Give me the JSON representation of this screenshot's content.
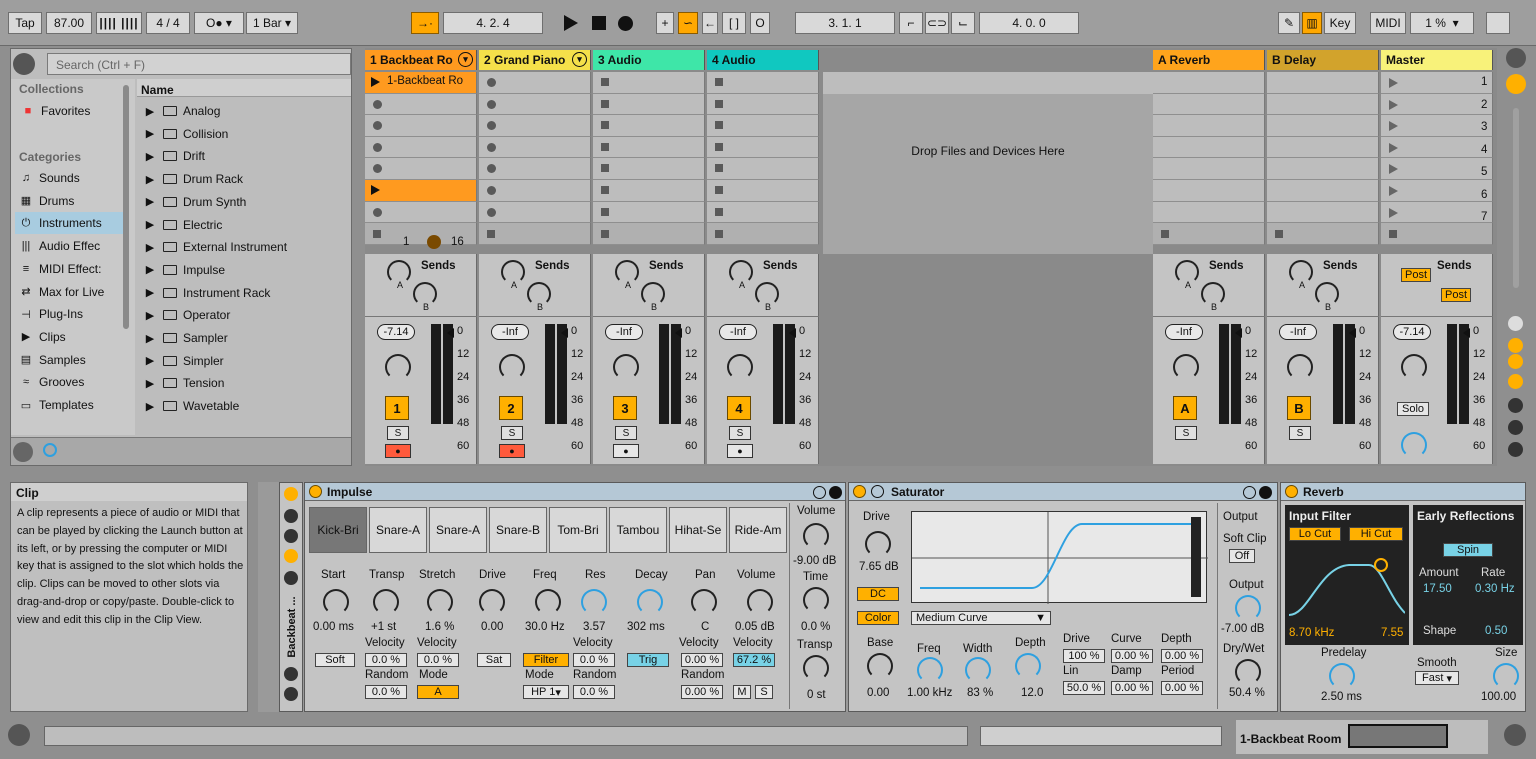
{
  "transport": {
    "tap": "Tap",
    "tempo": "87.00",
    "signature": "4 / 4",
    "quantize": "1 Bar",
    "arrangement_pos": "4.  2.  4",
    "loop_start": "3.  1.  1",
    "loop_length": "4.  0.  0",
    "key": "Key",
    "midi": "MIDI",
    "cpu": "1 %"
  },
  "browser": {
    "search_placeholder": "Search (Ctrl + F)",
    "collections_header": "Collections",
    "favorites": "Favorites",
    "categories_header": "Categories",
    "name_header": "Name",
    "categories": [
      "Sounds",
      "Drums",
      "Instruments",
      "Audio Effec",
      "MIDI Effect:",
      "Max for Live",
      "Plug-Ins",
      "Clips",
      "Samples",
      "Grooves",
      "Templates"
    ],
    "items": [
      "Analog",
      "Collision",
      "Drift",
      "Drum Rack",
      "Drum Synth",
      "Electric",
      "External Instrument",
      "Impulse",
      "Instrument Rack",
      "Operator",
      "Sampler",
      "Simpler",
      "Tension",
      "Wavetable"
    ]
  },
  "session": {
    "drop_text": "Drop Files and Devices Here",
    "tracks": [
      {
        "name": "1 Backbeat Ro",
        "color": "#ff9a1f",
        "volume": "-7.14",
        "num": "1",
        "clip": "1-Backbeat Ro"
      },
      {
        "name": "2 Grand Piano",
        "color": "#f5e04a",
        "volume": "-Inf",
        "num": "2"
      },
      {
        "name": "3 Audio",
        "color": "#3ee6a8",
        "volume": "-Inf",
        "num": "3"
      },
      {
        "name": "4 Audio",
        "color": "#10c8c0",
        "volume": "-Inf",
        "num": "4"
      }
    ],
    "returns": [
      {
        "name": "A Reverb",
        "color": "#ffa41c",
        "volume": "-Inf",
        "num": "A"
      },
      {
        "name": "B Delay",
        "color": "#d2a32c",
        "volume": "-Inf",
        "num": "B"
      }
    ],
    "master": {
      "name": "Master",
      "color": "#f8f27a",
      "volume": "-7.14",
      "solo": "Solo",
      "post": "Post"
    },
    "sends": "Sends",
    "solo_btn": "S",
    "scale": [
      "0",
      "12",
      "24",
      "36",
      "48",
      "60"
    ],
    "scenes": [
      "1",
      "2",
      "3",
      "4",
      "5",
      "6",
      "7"
    ],
    "loop_len": "16",
    "loop_num": "1"
  },
  "info": {
    "title": "Clip",
    "text": "A clip represents a piece of audio or MIDI that can be played by clicking the Launch button at its left, or by pressing the computer or MIDI key that is assigned to the slot which holds the clip. Clips can be moved to other slots via drag-and-drop or copy/paste. Double-click to view and edit this clip in the Clip View."
  },
  "impulse": {
    "title": "Impulse",
    "rack_label": "Backbeat ...",
    "pads": [
      "Kick-Bri",
      "Snare-A",
      "Snare-A",
      "Snare-B",
      "Tom-Bri",
      "Tambou",
      "Hihat-Se",
      "Ride-Am"
    ],
    "volume_label": "Volume",
    "volume_val": "-9.00 dB",
    "time_label": "Time",
    "time_val": "0.0 %",
    "transp_label": "Transp",
    "transp_val": "0 st",
    "start": "Start",
    "start_val": "0.00 ms",
    "soft": "Soft",
    "transp": "Transp",
    "transp2_val": "+1 st",
    "stretch": "Stretch",
    "stretch_val": "1.6 %",
    "velocity": "Velocity",
    "random": "Random",
    "mode": "Mode",
    "mode_val": "A",
    "drive": "Drive",
    "drive_val": "0.00",
    "sat": "Sat",
    "freq": "Freq",
    "freq_val": "30.0 Hz",
    "res": "Res",
    "res_val": "3.57",
    "filter": "Filter",
    "hp": "HP 1",
    "decay": "Decay",
    "decay_val": "302 ms",
    "trig": "Trig",
    "pan": "Pan",
    "pan_val": "C",
    "vol": "Volume",
    "vol_val": "0.05 dB",
    "vel_val": "67.2 %",
    "m": "M",
    "s": "S",
    "pct0": "0.0 %",
    "pct00": "0.00 %"
  },
  "saturator": {
    "title": "Saturator",
    "drive": "Drive",
    "drive_val": "7.65 dB",
    "dc": "DC",
    "color": "Color",
    "curve": "Medium Curve",
    "base": "Base",
    "base_val": "0.00",
    "freq": "Freq",
    "freq_val": "1.00 kHz",
    "width": "Width",
    "width_val": "83 %",
    "depth": "Depth",
    "depth_val": "12.0",
    "drive2": "Drive",
    "curve2": "Curve",
    "depth2": "Depth",
    "lin": "Lin",
    "damp": "Damp",
    "period": "Period",
    "v100": "100 %",
    "v000": "0.00 %",
    "v50": "50.0 %",
    "output": "Output",
    "softclip": "Soft Clip",
    "off": "Off",
    "output2": "Output",
    "out_val": "-7.00 dB",
    "drywet": "Dry/Wet",
    "dw_val": "50.4 %"
  },
  "reverb": {
    "title": "Reverb",
    "input_filter": "Input Filter",
    "lo": "Lo Cut",
    "hi": "Hi Cut",
    "freq": "8.70 kHz",
    "q": "7.55",
    "er": "Early Reflections",
    "spin": "Spin",
    "amount": "Amount",
    "amount_val": "17.50",
    "rate": "Rate",
    "rate_val": "0.30 Hz",
    "shape": "Shape",
    "shape_val": "0.50",
    "predelay": "Predelay",
    "predelay_val": "2.50 ms",
    "smooth": "Smooth",
    "fast": "Fast",
    "size": "Size",
    "size_val": "100.00"
  },
  "status": {
    "clip_name": "1-Backbeat Room"
  },
  "colors": {
    "accent": "#ffb000",
    "clip_orange": "#ff9a1f",
    "blue": "#2ea0e0"
  }
}
